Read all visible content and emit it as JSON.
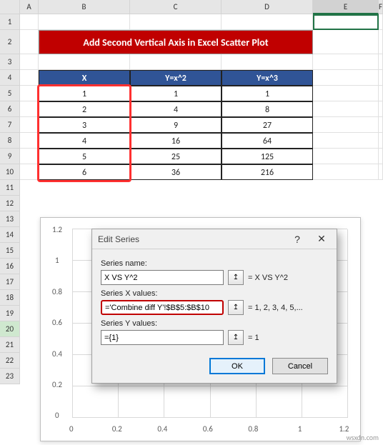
{
  "columns": [
    "A",
    "B",
    "C",
    "D",
    "E",
    "F"
  ],
  "rows_visible": [
    1,
    2,
    3,
    4,
    5,
    6,
    7,
    8,
    9,
    10,
    11,
    12,
    13,
    14,
    15,
    16,
    17,
    18,
    19,
    20,
    21,
    22,
    23
  ],
  "selected_cell_col": "E",
  "title_banner": "Add Second  Vertical Axis in Excel Scatter Plot",
  "table": {
    "headers": [
      "X",
      "Y=x^2",
      "Y=x^3"
    ],
    "rows": [
      [
        "1",
        "1",
        "1"
      ],
      [
        "2",
        "4",
        "8"
      ],
      [
        "3",
        "9",
        "27"
      ],
      [
        "4",
        "16",
        "64"
      ],
      [
        "5",
        "25",
        "125"
      ],
      [
        "6",
        "36",
        "216"
      ]
    ]
  },
  "dialog": {
    "title": "Edit Series",
    "labels": {
      "name": "Series name:",
      "x": "Series X values:",
      "y": "Series Y values:"
    },
    "values": {
      "name": "X VS Y^2",
      "x": "='Combine diff Y'!$B$5:$B$10",
      "y": "={1}"
    },
    "results": {
      "name": "= X VS Y^2",
      "x": "= 1, 2, 3, 4, 5,...",
      "y": "= 1"
    },
    "buttons": {
      "ok": "OK",
      "cancel": "Cancel"
    }
  },
  "chart_data": {
    "type": "scatter",
    "series": [
      {
        "name": "X VS Y^2",
        "x": [
          1
        ],
        "y": [
          1
        ]
      }
    ],
    "xlabel": "",
    "ylabel": "",
    "xlim": [
      0,
      1.2
    ],
    "ylim": [
      0,
      1.2
    ],
    "xticks": [
      0,
      0.2,
      0.4,
      0.6,
      0.8,
      1,
      1.2
    ],
    "yticks": [
      0,
      0.2,
      0.4,
      0.6,
      0.8,
      1,
      1.2
    ]
  },
  "watermark": "wsxdn.com"
}
